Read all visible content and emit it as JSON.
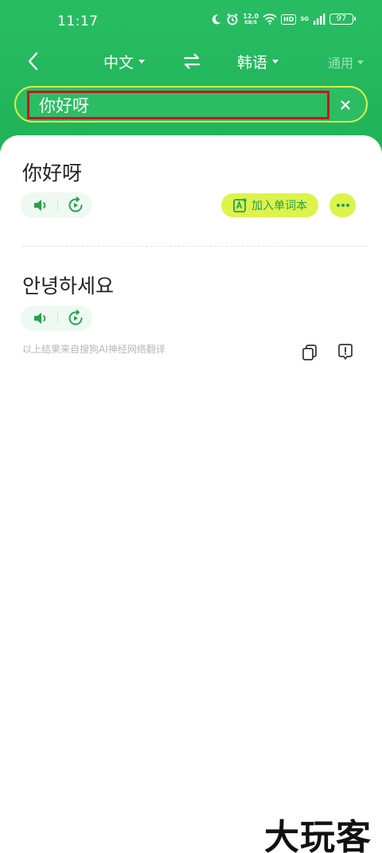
{
  "status_bar": {
    "time": "11:17",
    "net_speed_value": "12.0",
    "net_speed_unit": "KB/S",
    "hd_label": "HD",
    "network_label": "5G",
    "battery_level": "97"
  },
  "nav": {
    "source_language": "中文",
    "target_language": "韩语",
    "mode": "通用"
  },
  "search": {
    "value": "你好呀"
  },
  "result": {
    "source_text": "你好呀",
    "add_wordbook_label": "加入单词本",
    "translation": "안녕하세요",
    "credit": "以上结果来自搜狗AI神经网络翻译"
  },
  "watermark": "大玩客",
  "colors": {
    "header_green": "#29bd63",
    "accent_lime": "#ddf34b",
    "icon_green": "#26a04f",
    "highlight_red": "#c8161d"
  },
  "icons": {
    "back": "chevron-left-icon",
    "swap": "swap-arrows-icon",
    "clear": "close-icon",
    "speaker": "speaker-icon",
    "replay": "replay-icon",
    "wordbook": "add-word-icon",
    "more": "more-dots-icon",
    "copy": "copy-icon",
    "report": "report-icon"
  }
}
